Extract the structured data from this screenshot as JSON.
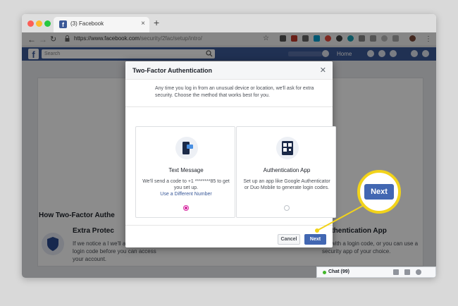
{
  "browser": {
    "tab_title": "(3) Facebook",
    "url_host": "https://www.facebook.com",
    "url_path": "/security/2fac/setup/intro/"
  },
  "facebook": {
    "search_placeholder": "Search",
    "home_label": "Home"
  },
  "page": {
    "how_title": "How Two-Factor Authe",
    "extra_title": "Extra Protec",
    "extra_desc": "If we notice a l we'll ask for a login code before you can access your account.",
    "auth_title": "Authentication App",
    "auth_desc": "gle with a login code, or you can use a security app of your choice."
  },
  "chat": {
    "label": "Chat (99)"
  },
  "modal": {
    "title": "Two-Factor Authentication",
    "intro": "Any time you log in from an unusual device or location, we'll ask for extra security. Choose the method that works best for you.",
    "options": [
      {
        "title": "Text Message",
        "desc": "We'll send a code to +1 ********85 to get you set up.",
        "link": "Use a Different Number",
        "selected": true
      },
      {
        "title": "Authentication App",
        "desc": "Set up an app like Google Authenticator or Duo Mobile to generate login codes.",
        "selected": false
      }
    ],
    "cancel_label": "Cancel",
    "next_label": "Next"
  },
  "callout": {
    "label": "Next",
    "color": "#f2d31a"
  },
  "colors": {
    "facebook_blue": "#3b5998",
    "button_blue": "#4267b2"
  }
}
